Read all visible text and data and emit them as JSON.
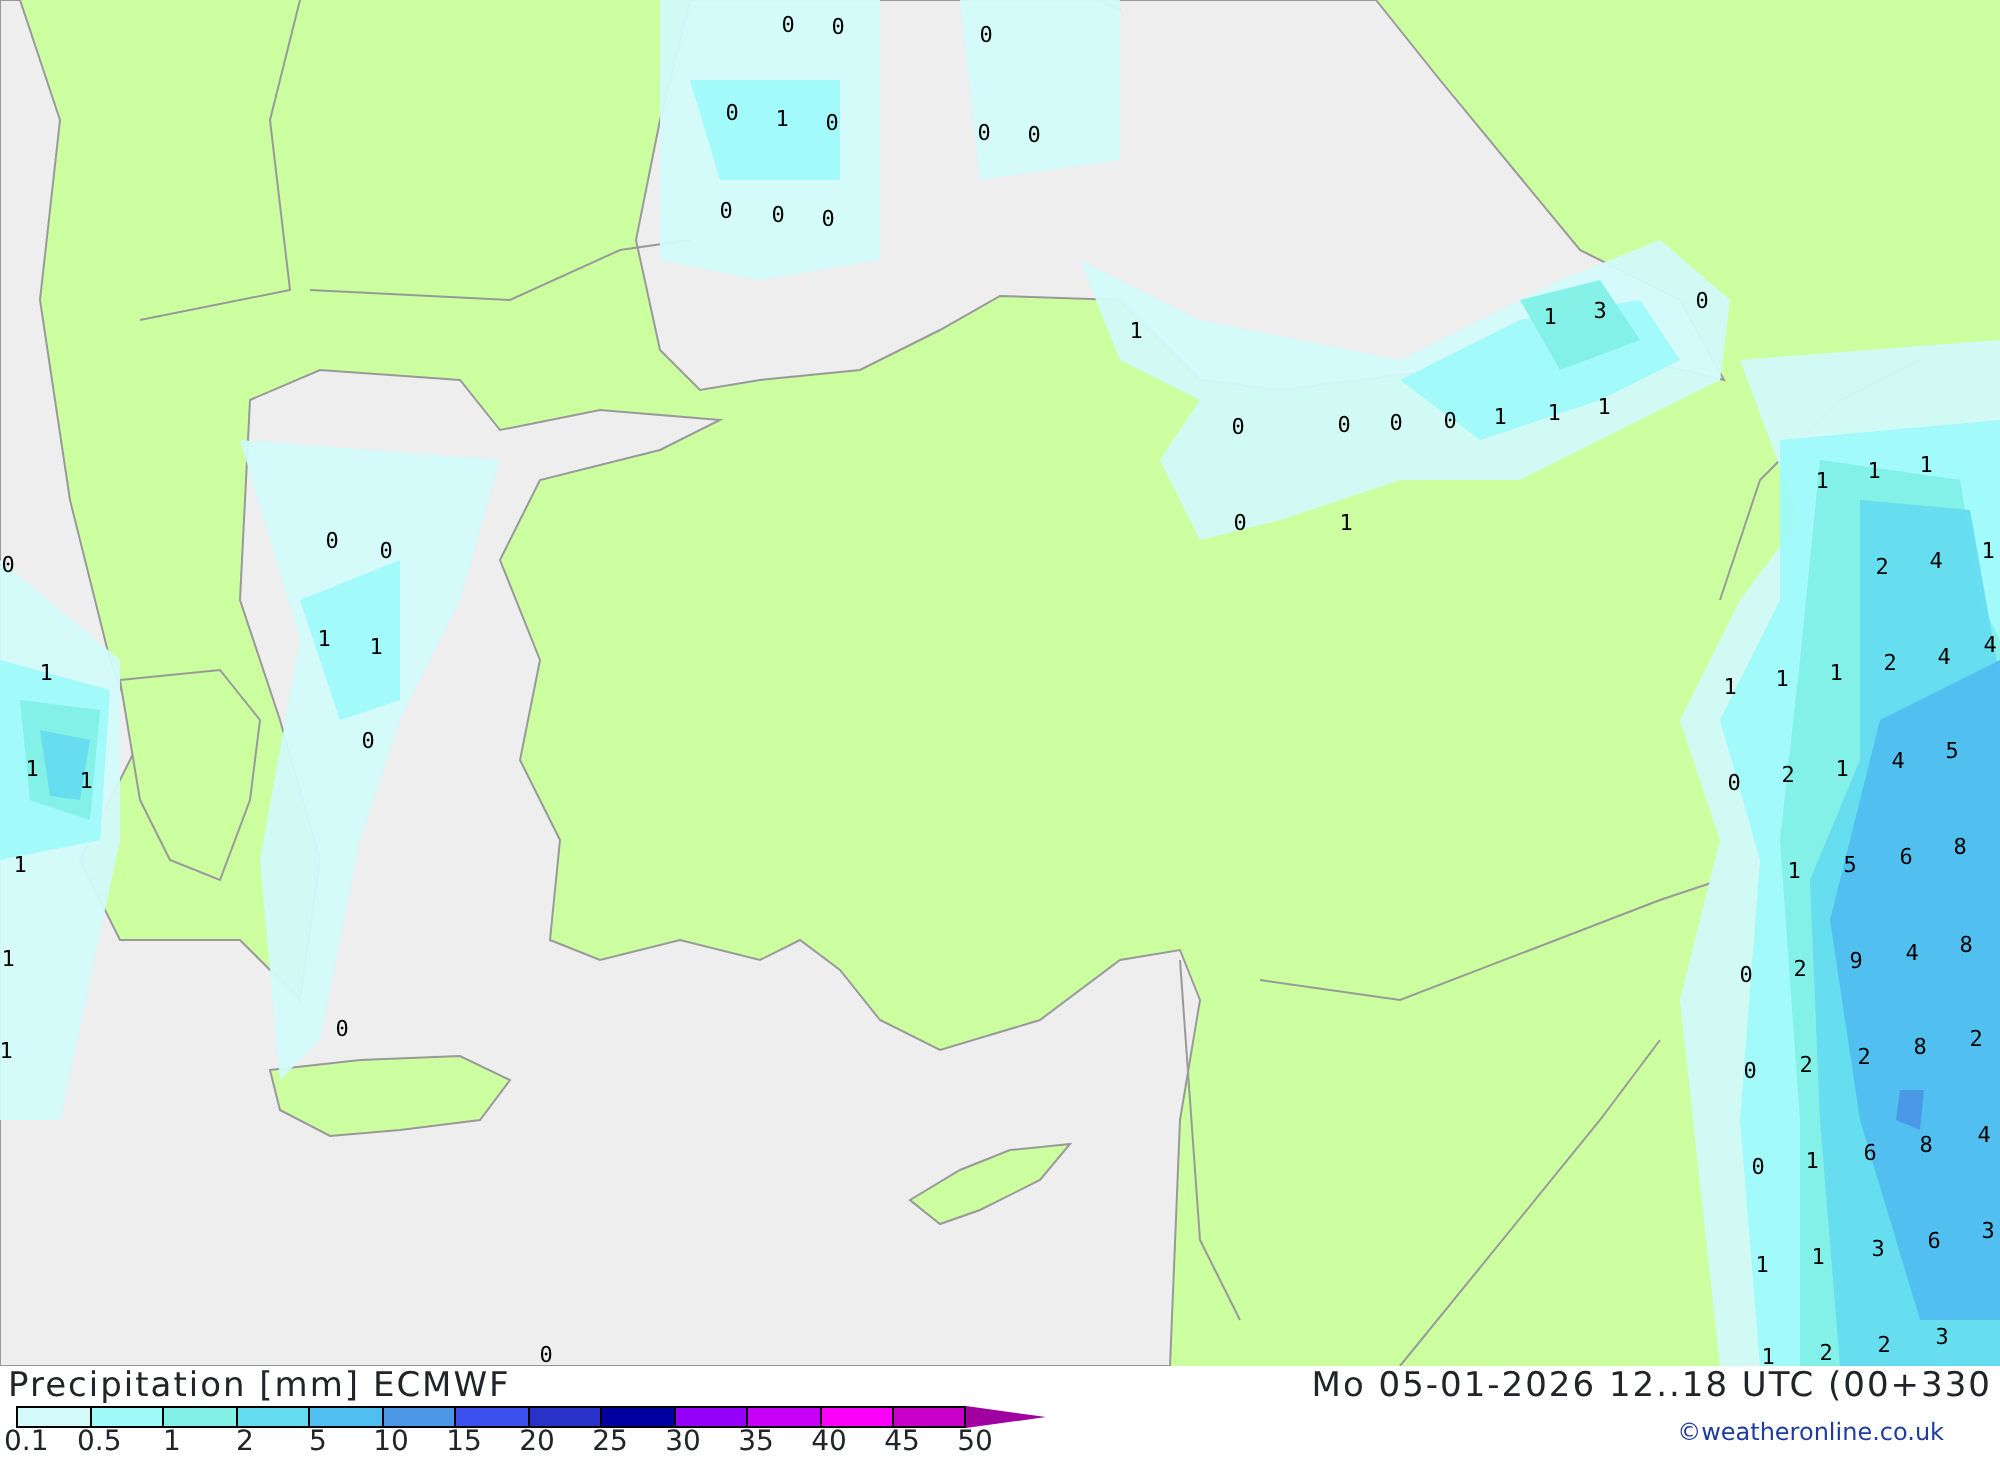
{
  "map": {
    "values": [
      "0",
      "0",
      "0",
      "0",
      "1",
      "0",
      "0",
      "0",
      "0",
      "0",
      "0",
      "1",
      "1",
      "3",
      "0",
      "0",
      "0",
      "0",
      "0",
      "1",
      "1",
      "1",
      "0",
      "1",
      "0",
      "0",
      "0",
      "1",
      "1",
      "1",
      "1",
      "1",
      "0",
      "1",
      "1",
      "1",
      "0",
      "0",
      "1",
      "1",
      "1",
      "1",
      "2",
      "4",
      "1",
      "1",
      "1",
      "2",
      "4",
      "4",
      "0",
      "2",
      "1",
      "4",
      "5",
      "1",
      "5",
      "6",
      "8",
      "0",
      "2",
      "9",
      "4",
      "8",
      "0",
      "2",
      "2",
      "8",
      "2",
      "0",
      "1",
      "6",
      "8",
      "4",
      "1",
      "1",
      "3",
      "6",
      "3",
      "1",
      "2",
      "2",
      "3"
    ]
  },
  "legend": {
    "title": "Precipitation [mm] ECMWF",
    "date": "Mo 05-01-2026 12..18 UTC (00+330",
    "swatches": [
      {
        "color": "#d2fafa"
      },
      {
        "color": "#a0fafa"
      },
      {
        "color": "#82f0e6"
      },
      {
        "color": "#64dcf0"
      },
      {
        "color": "#50bef0"
      },
      {
        "color": "#4b96e6"
      },
      {
        "color": "#3c50f0"
      },
      {
        "color": "#2832c8"
      },
      {
        "color": "#0000a0"
      },
      {
        "color": "#9600fa"
      },
      {
        "color": "#c800fa"
      },
      {
        "color": "#fa00fa"
      },
      {
        "color": "#c800c8"
      }
    ],
    "labels": [
      "0.1",
      "0.5",
      "1",
      "2",
      "5",
      "10",
      "15",
      "20",
      "25",
      "30",
      "35",
      "40",
      "45",
      "50"
    ],
    "credit": "©weatheronline.co.uk"
  }
}
